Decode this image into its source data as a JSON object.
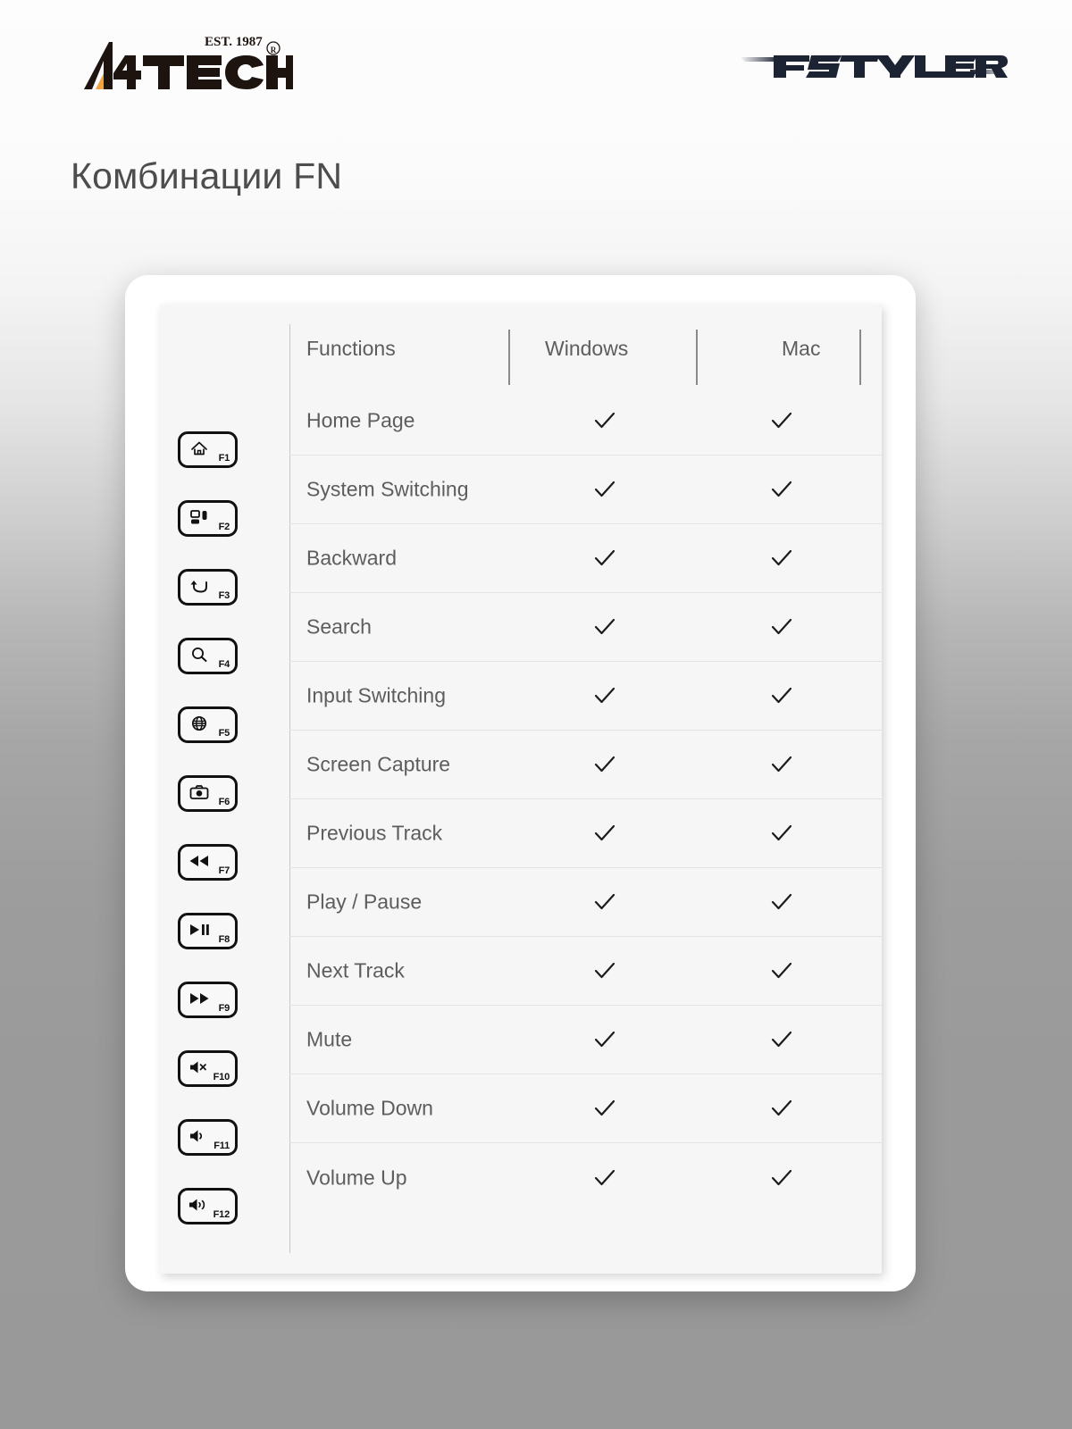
{
  "brand": {
    "logo_primary": "A4TECH",
    "logo_primary_tagline": "EST. 1987",
    "logo_primary_trademark": "®",
    "logo_secondary": "FSTYLER",
    "accent_color": "#f5a33c",
    "logo_primary_color": "#1d140f",
    "logo_secondary_color": "#1c2333"
  },
  "page": {
    "title": "Комбинации FN",
    "title_color": "#4d4d4d",
    "background_top_color": "#fdfdfd",
    "background_bottom_color": "#999999"
  },
  "table": {
    "headers": {
      "functions": "Functions",
      "windows": "Windows",
      "mac": "Mac"
    },
    "check_glyph": "check-icon",
    "rows": [
      {
        "key": "F1",
        "key_icon": "home-icon",
        "function": "Home Page",
        "windows": true,
        "mac": true
      },
      {
        "key": "F2",
        "key_icon": "system-switch-icon",
        "function": "System Switching",
        "windows": true,
        "mac": true
      },
      {
        "key": "F3",
        "key_icon": "back-arrow-icon",
        "function": "Backward",
        "windows": true,
        "mac": true
      },
      {
        "key": "F4",
        "key_icon": "search-icon",
        "function": "Search",
        "windows": true,
        "mac": true
      },
      {
        "key": "F5",
        "key_icon": "globe-icon",
        "function": "Input Switching",
        "windows": true,
        "mac": true
      },
      {
        "key": "F6",
        "key_icon": "camera-icon",
        "function": "Screen Capture",
        "windows": true,
        "mac": true
      },
      {
        "key": "F7",
        "key_icon": "rewind-icon",
        "function": "Previous Track",
        "windows": true,
        "mac": true
      },
      {
        "key": "F8",
        "key_icon": "play-pause-icon",
        "function": "Play / Pause",
        "windows": true,
        "mac": true
      },
      {
        "key": "F9",
        "key_icon": "fast-forward-icon",
        "function": "Next Track",
        "windows": true,
        "mac": true
      },
      {
        "key": "F10",
        "key_icon": "mute-icon",
        "function": "Mute",
        "windows": true,
        "mac": true
      },
      {
        "key": "F11",
        "key_icon": "volume-down-icon",
        "function": "Volume Down",
        "windows": true,
        "mac": true
      },
      {
        "key": "F12",
        "key_icon": "volume-up-icon",
        "function": "Volume Up",
        "windows": true,
        "mac": true
      }
    ]
  }
}
